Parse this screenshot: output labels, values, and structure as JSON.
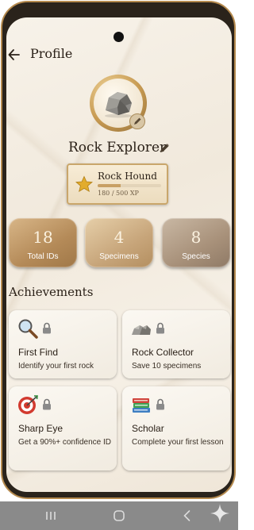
{
  "header": {
    "title": "Profile"
  },
  "profile": {
    "name": "Rock Explorer"
  },
  "rank": {
    "title": "Rock Hound",
    "xp_text": "180 / 500 XP",
    "xp_fraction": 0.36
  },
  "stats": [
    {
      "value": "18",
      "label": "Total IDs"
    },
    {
      "value": "4",
      "label": "Specimens"
    },
    {
      "value": "8",
      "label": "Species"
    }
  ],
  "achievements": {
    "heading": "Achievements",
    "items": [
      {
        "title": "First Find",
        "desc": "Identify your first rock",
        "icon": "magnifier-icon",
        "locked": true
      },
      {
        "title": "Rock Collector",
        "desc": "Save 10 specimens",
        "icon": "rocks-icon",
        "locked": true
      },
      {
        "title": "Sharp Eye",
        "desc": "Get a 90%+ confidence ID",
        "icon": "target-icon",
        "locked": true
      },
      {
        "title": "Scholar",
        "desc": "Complete your first lesson",
        "icon": "books-icon",
        "locked": true
      }
    ]
  },
  "colors": {
    "accent": "#c9a66b",
    "background": "#f3ece1",
    "text": "#2b2118"
  }
}
